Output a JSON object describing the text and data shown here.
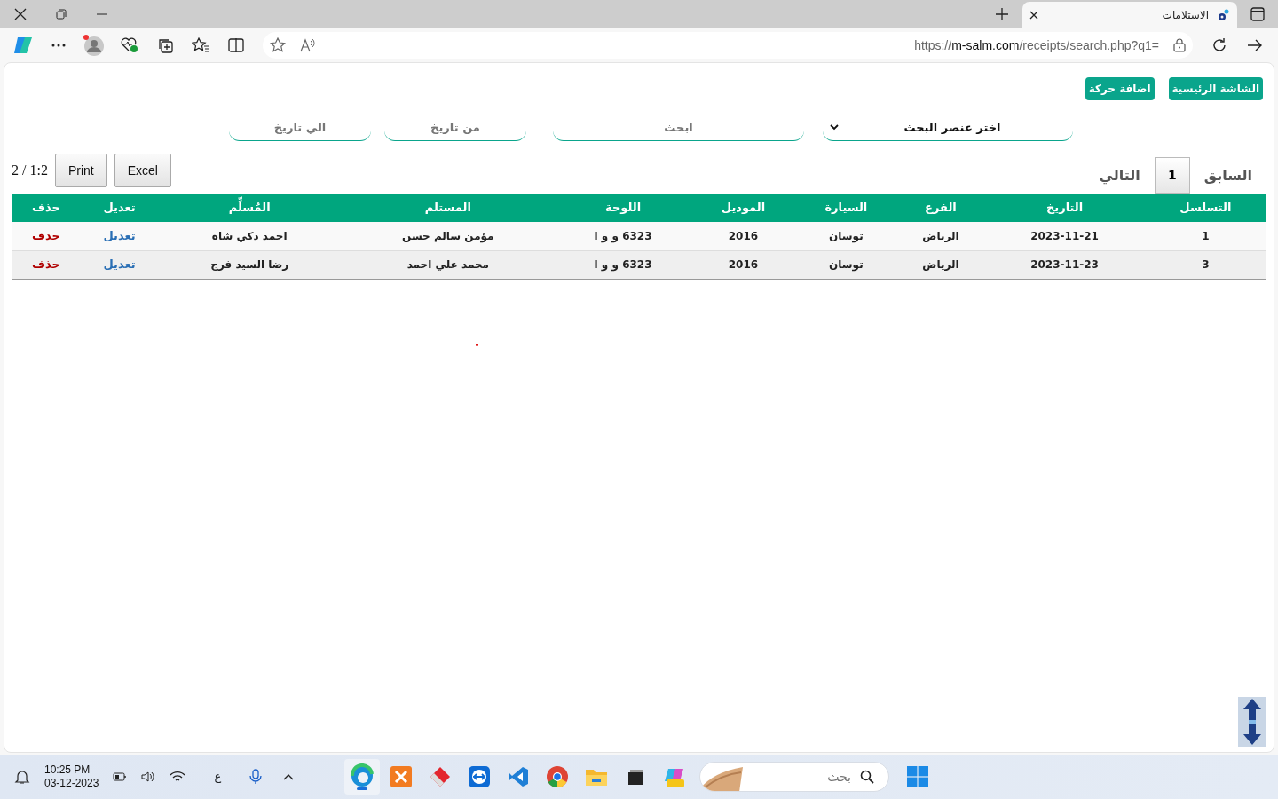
{
  "browser": {
    "tab": {
      "title": "الاستلامات",
      "selected": true
    },
    "url": {
      "scheme": "https://",
      "host": "m-salm.com",
      "path": "/receipts/search.php?q1="
    }
  },
  "toolbar": {
    "buttons": [
      "الشاشة الرئيسية",
      "اضافة حركة"
    ]
  },
  "filters": {
    "select": {
      "value": "اختر عنصر البحث"
    },
    "search": {
      "placeholder": "ابحث"
    },
    "from_date": {
      "placeholder": "من تاريخ"
    },
    "to_date": {
      "placeholder": "الي تاريخ"
    }
  },
  "pagination": {
    "previous": "السابق",
    "pages": [
      {
        "label": "1",
        "selected": true
      }
    ],
    "next": "التالي"
  },
  "export_buttons": [
    "Excel",
    "Print"
  ],
  "record_count": "2 / 1:2",
  "table": {
    "columns": [
      {
        "label": "التسلسل",
        "kind": "text"
      },
      {
        "label": "التاريخ",
        "kind": "text"
      },
      {
        "label": "الفرع",
        "kind": "text"
      },
      {
        "label": "السيارة",
        "kind": "text"
      },
      {
        "label": "الموديل",
        "kind": "text"
      },
      {
        "label": "اللوحة",
        "kind": "text"
      },
      {
        "label": "المستلم",
        "kind": "text"
      },
      {
        "label": "المُسلِّم",
        "kind": "text"
      },
      {
        "label": "تعديل",
        "kind": "edit"
      },
      {
        "label": "حذف",
        "kind": "delete"
      }
    ],
    "rows": [
      {
        "cells": [
          "1",
          "2023-11-21",
          "الرياض",
          "توسان",
          "2016",
          "6323 و و ا",
          "مؤمن سالم حسن",
          "احمد ذكي شاه",
          "تعديل",
          "حذف"
        ]
      },
      {
        "cells": [
          "3",
          "2023-11-23",
          "الرياض",
          "توسان",
          "2016",
          "6323 و و ا",
          "محمد علي احمد",
          "رضا السيد فرج",
          "تعديل",
          "حذف"
        ]
      }
    ]
  },
  "taskbar": {
    "time": "10:25 PM",
    "date": "03-12-2023",
    "input_language": "ع",
    "search": {
      "placeholder": "بحث"
    }
  }
}
